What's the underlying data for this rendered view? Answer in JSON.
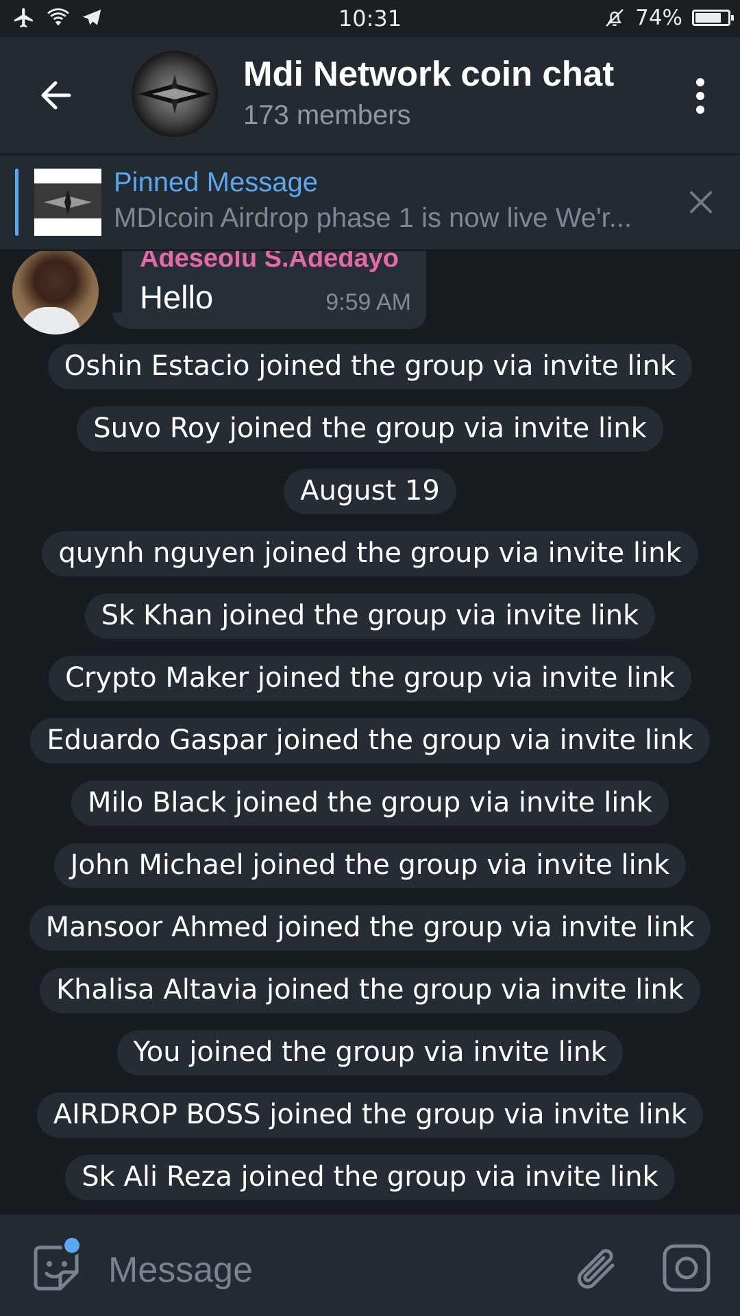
{
  "status_bar": {
    "time": "10:31",
    "battery_percent": "74%",
    "battery_level": 0.74,
    "icons": [
      "airplane-icon",
      "wifi-icon",
      "telegram-icon",
      "bell-muted-icon",
      "battery-icon"
    ]
  },
  "header": {
    "title": "Mdi Network coin chat",
    "subtitle": "173 members"
  },
  "pinned": {
    "title": "Pinned Message",
    "text": "MDIcoin Airdrop phase 1 is now live We'r..."
  },
  "message": {
    "sender": "Adeseolu S.Adedayo",
    "text": "Hello",
    "time": "9:59 AM"
  },
  "service_messages": [
    "Oshin Estacio joined the group via invite link",
    "Suvo Roy joined the group via invite link",
    "August 19",
    "quynh nguyen joined the group via invite link",
    "Sk Khan joined the group via invite link",
    "Crypto Maker joined the group via invite link",
    "Eduardo Gaspar joined the group via invite link",
    "Milo Black joined the group via invite link",
    "John Michael joined the group via invite link",
    "Mansoor Ahmed joined the group via invite link",
    "Khalisa Altavia joined the group via invite link",
    "You joined the group via invite link",
    "AIRDROP BOSS joined the group via invite link",
    "Sk Ali Reza joined the group via invite link"
  ],
  "input": {
    "placeholder": "Message"
  },
  "colors": {
    "accent": "#5ba7f0",
    "sender_name": "#e768a7",
    "background": "#171c21"
  }
}
